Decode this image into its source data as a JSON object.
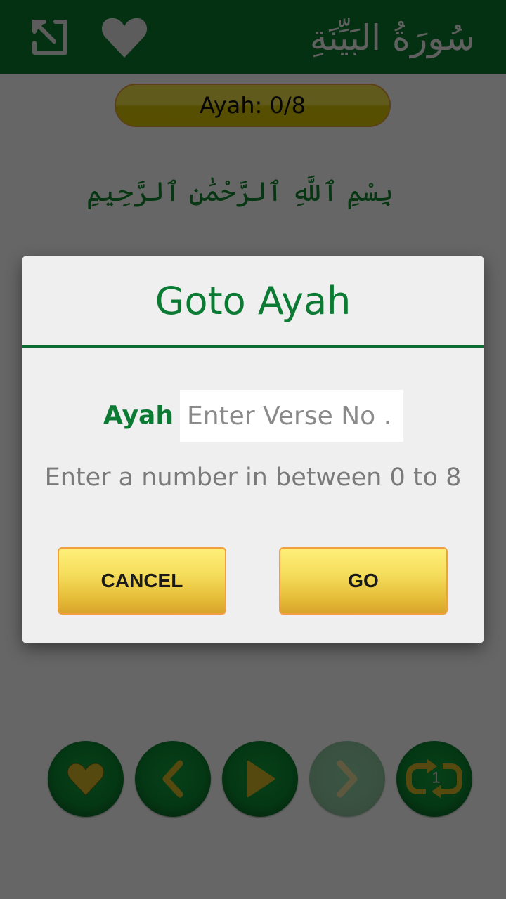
{
  "topbar": {
    "expand_icon": "expand-arrow-icon",
    "favorite_icon": "heart-icon",
    "surah_title": "سُورَةُ البَيِّنَةِ"
  },
  "ayah_counter": {
    "label": "Ayah: 0/8"
  },
  "bismillah": "بِسْمِ ٱللَّهِ ٱلرَّحْمَٰنِ ٱلرَّحِيمِ",
  "controls": [
    {
      "name": "favorite",
      "icon": "heart-icon",
      "enabled": true
    },
    {
      "name": "previous",
      "icon": "chevron-left-icon",
      "enabled": true
    },
    {
      "name": "play",
      "icon": "play-icon",
      "enabled": true
    },
    {
      "name": "next",
      "icon": "chevron-right-icon",
      "enabled": false
    },
    {
      "name": "repeat",
      "icon": "repeat-icon",
      "enabled": true,
      "count": "1"
    }
  ],
  "dialog": {
    "title": "Goto Ayah",
    "field_label": "Ayah",
    "input_value": "",
    "input_placeholder": "Enter Verse No .",
    "hint": "Enter a number in between 0 to 8",
    "cancel_label": "CANCEL",
    "go_label": "GO"
  },
  "colors": {
    "primary_green": "#0a7a2f",
    "accent_gold": "#f5dd5c",
    "icon_gold": "#d4b62a"
  }
}
